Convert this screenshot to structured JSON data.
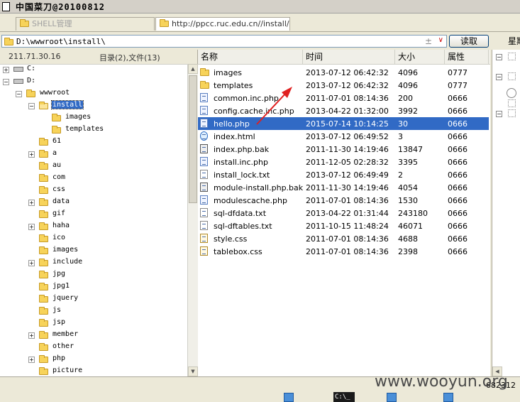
{
  "window": {
    "title": "中国菜刀@20100812"
  },
  "tabs": [
    {
      "label": "SHELL管理",
      "active": false
    },
    {
      "label": "http://ppcc.ruc.edu.cn//install/...",
      "active": true
    }
  ],
  "pathbar": {
    "path": "D:\\wwwroot\\install\\",
    "read_button": "读取",
    "right_label": "星期"
  },
  "left_header": {
    "ip": "211.71.30.16",
    "count": "目录(2),文件(13)"
  },
  "tree": [
    {
      "label": "C:",
      "level": 0,
      "type": "drive",
      "expander": "+"
    },
    {
      "label": "D:",
      "level": 0,
      "type": "drive",
      "expander": "-"
    },
    {
      "label": "wwwroot",
      "level": 1,
      "type": "folder",
      "expander": "-"
    },
    {
      "label": "install",
      "level": 2,
      "type": "folder-open",
      "expander": "-",
      "selected": true
    },
    {
      "label": "images",
      "level": 3,
      "type": "folder",
      "expander": ""
    },
    {
      "label": "templates",
      "level": 3,
      "type": "folder",
      "expander": ""
    },
    {
      "label": "61",
      "level": 2,
      "type": "folder",
      "expander": ""
    },
    {
      "label": "a",
      "level": 2,
      "type": "folder",
      "expander": "+"
    },
    {
      "label": "au",
      "level": 2,
      "type": "folder",
      "expander": ""
    },
    {
      "label": "com",
      "level": 2,
      "type": "folder",
      "expander": ""
    },
    {
      "label": "css",
      "level": 2,
      "type": "folder",
      "expander": ""
    },
    {
      "label": "data",
      "level": 2,
      "type": "folder",
      "expander": "+"
    },
    {
      "label": "gif",
      "level": 2,
      "type": "folder",
      "expander": ""
    },
    {
      "label": "haha",
      "level": 2,
      "type": "folder",
      "expander": "+"
    },
    {
      "label": "ico",
      "level": 2,
      "type": "folder",
      "expander": ""
    },
    {
      "label": "images",
      "level": 2,
      "type": "folder",
      "expander": ""
    },
    {
      "label": "include",
      "level": 2,
      "type": "folder",
      "expander": "+"
    },
    {
      "label": "jpg",
      "level": 2,
      "type": "folder",
      "expander": ""
    },
    {
      "label": "jpg1",
      "level": 2,
      "type": "folder",
      "expander": ""
    },
    {
      "label": "jquery",
      "level": 2,
      "type": "folder",
      "expander": ""
    },
    {
      "label": "js",
      "level": 2,
      "type": "folder",
      "expander": ""
    },
    {
      "label": "jsp",
      "level": 2,
      "type": "folder",
      "expander": ""
    },
    {
      "label": "member",
      "level": 2,
      "type": "folder",
      "expander": "+"
    },
    {
      "label": "other",
      "level": 2,
      "type": "folder",
      "expander": ""
    },
    {
      "label": "php",
      "level": 2,
      "type": "folder",
      "expander": "+"
    },
    {
      "label": "picture",
      "level": 2,
      "type": "folder",
      "expander": ""
    }
  ],
  "file_columns": {
    "name": "名称",
    "time": "时间",
    "size": "大小",
    "attr": "属性"
  },
  "files": [
    {
      "name": "images",
      "time": "2013-07-12 06:42:32",
      "size": "4096",
      "attr": "0777",
      "icon": "folder"
    },
    {
      "name": "templates",
      "time": "2013-07-12 06:42:32",
      "size": "4096",
      "attr": "0777",
      "icon": "folder"
    },
    {
      "name": "common.inc.php",
      "time": "2011-07-01 08:14:36",
      "size": "200",
      "attr": "0666",
      "icon": "php"
    },
    {
      "name": "config.cache.inc.php",
      "time": "2013-04-22 01:32:00",
      "size": "3992",
      "attr": "0666",
      "icon": "php"
    },
    {
      "name": "hello.php",
      "time": "2015-07-14 10:14:25",
      "size": "30",
      "attr": "0666",
      "icon": "php",
      "selected": true
    },
    {
      "name": "index.html",
      "time": "2013-07-12 06:49:52",
      "size": "3",
      "attr": "0666",
      "icon": "html"
    },
    {
      "name": "index.php.bak",
      "time": "2011-11-30 14:19:46",
      "size": "13847",
      "attr": "0666",
      "icon": "bak"
    },
    {
      "name": "install.inc.php",
      "time": "2011-12-05 02:28:32",
      "size": "3395",
      "attr": "0666",
      "icon": "php"
    },
    {
      "name": "install_lock.txt",
      "time": "2013-07-12 06:49:49",
      "size": "2",
      "attr": "0666",
      "icon": "txt"
    },
    {
      "name": "module-install.php.bak",
      "time": "2011-11-30 14:19:46",
      "size": "4054",
      "attr": "0666",
      "icon": "bak"
    },
    {
      "name": "modulescache.php",
      "time": "2011-07-01 08:14:36",
      "size": "1530",
      "attr": "0666",
      "icon": "php"
    },
    {
      "name": "sql-dfdata.txt",
      "time": "2013-04-22 01:31:44",
      "size": "243180",
      "attr": "0666",
      "icon": "txt"
    },
    {
      "name": "sql-dftables.txt",
      "time": "2011-10-15 11:48:24",
      "size": "46071",
      "attr": "0666",
      "icon": "txt"
    },
    {
      "name": "style.css",
      "time": "2011-07-01 08:14:36",
      "size": "4688",
      "attr": "0666",
      "icon": "css"
    },
    {
      "name": "tablebox.css",
      "time": "2011-07-01 08:14:36",
      "size": "2398",
      "attr": "0666",
      "icon": "css"
    }
  ],
  "status": {
    "right_value": "682312"
  },
  "taskbar": {
    "cmd_label": "C:\\_"
  },
  "watermark": "www.wooyun.org",
  "colors": {
    "selection": "#316ac5",
    "arrow": "#e02020"
  }
}
